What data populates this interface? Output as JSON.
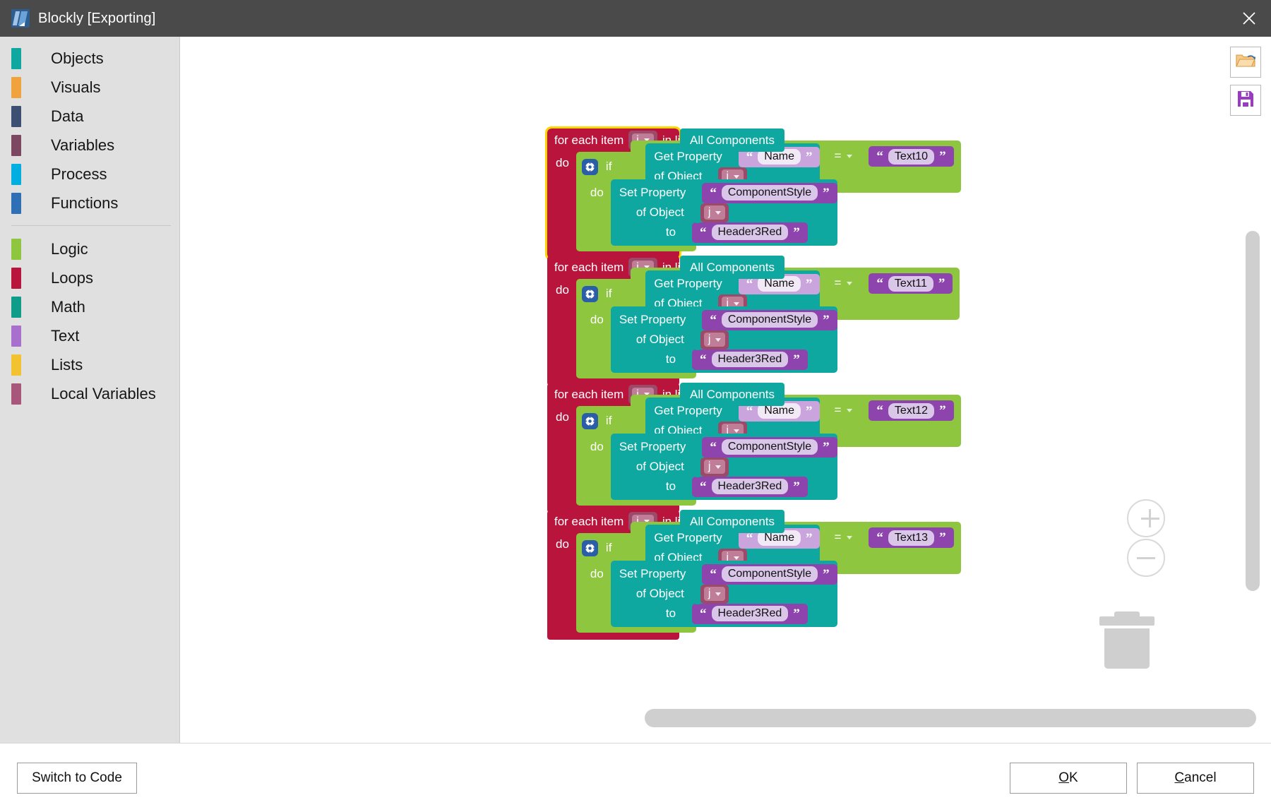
{
  "window": {
    "title": "Blockly [Exporting]",
    "app_icon": "blockly-logo-icon",
    "close_icon": "close-icon"
  },
  "toolbox": {
    "groups": [
      {
        "items": [
          {
            "label": "Objects",
            "color": "#0fa8a0"
          },
          {
            "label": "Visuals",
            "color": "#f0a33c"
          },
          {
            "label": "Data",
            "color": "#3b5072"
          },
          {
            "label": "Variables",
            "color": "#7d4661"
          },
          {
            "label": "Process",
            "color": "#00aee0"
          },
          {
            "label": "Functions",
            "color": "#2f6fb5"
          }
        ]
      },
      {
        "items": [
          {
            "label": "Logic",
            "color": "#8ec63f"
          },
          {
            "label": "Loops",
            "color": "#b8143c"
          },
          {
            "label": "Math",
            "color": "#0f9d8a"
          },
          {
            "label": "Text",
            "color": "#a86fce"
          },
          {
            "label": "Lists",
            "color": "#f2c230"
          },
          {
            "label": "Local Variables",
            "color": "#a8577a"
          }
        ]
      }
    ]
  },
  "workspace": {
    "tools": [
      {
        "name": "open-file-button",
        "icon": "folder-open-icon"
      },
      {
        "name": "save-file-button",
        "icon": "floppy-save-icon"
      }
    ],
    "zoom_in_icon": "zoom-in-icon",
    "zoom_out_icon": "zoom-out-icon",
    "trash_icon": "trash-icon",
    "vertical_scrollbar": "vertical-scrollbar",
    "horizontal_scrollbar": "horizontal-scrollbar",
    "labels": {
      "for_each_item": "for each item",
      "in_list": "in list",
      "do": "do",
      "if": "if",
      "get_property": "Get Property",
      "set_property": "Set Property",
      "of_object": "of Object",
      "to": "to",
      "all_components": "All Components",
      "operator": "=",
      "gear_icon": "gear-icon"
    },
    "block_groups": [
      {
        "selected": true,
        "loop_var": "j",
        "list_source": "All Components",
        "property_name": "Name",
        "object_var": "j",
        "compare_op": "=",
        "compare_value": "Text10",
        "set_property_name": "ComponentStyle",
        "set_object_var": "j",
        "set_value": "Header3Red"
      },
      {
        "selected": false,
        "loop_var": "j",
        "list_source": "All Components",
        "property_name": "Name",
        "object_var": "j",
        "compare_op": "=",
        "compare_value": "Text11",
        "set_property_name": "ComponentStyle",
        "set_object_var": "j",
        "set_value": "Header3Red"
      },
      {
        "selected": false,
        "loop_var": "j",
        "list_source": "All Components",
        "property_name": "Name",
        "object_var": "j",
        "compare_op": "=",
        "compare_value": "Text12",
        "set_property_name": "ComponentStyle",
        "set_object_var": "j",
        "set_value": "Header3Red"
      },
      {
        "selected": false,
        "loop_var": "j",
        "list_source": "All Components",
        "property_name": "Name",
        "object_var": "j",
        "compare_op": "=",
        "compare_value": "Text13",
        "set_property_name": "ComponentStyle",
        "set_object_var": "j",
        "set_value": "Header3Red"
      }
    ]
  },
  "footer": {
    "switch_to_code": "Switch to Code",
    "ok": "OK",
    "cancel": "Cancel"
  }
}
